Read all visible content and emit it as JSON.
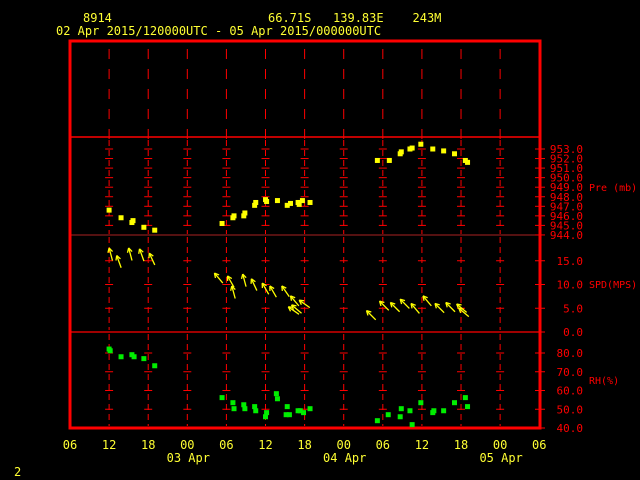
{
  "header": {
    "station_id": "8914",
    "location": "66.71S   139.83E    243M",
    "period": "02 Apr 2015/120000UTC - 05 Apr 2015/000000UTC"
  },
  "footer": {
    "page_number": "2"
  },
  "colors": {
    "frame": "#ff0000",
    "text": "#ffff33",
    "pressure": "#ffff00",
    "wind": "#ffff00",
    "rh": "#00ee00",
    "background": "#000000"
  },
  "chart_data": {
    "type": "scatter",
    "x_axis": {
      "range": [
        "2015-04-02T06:00Z",
        "2015-04-05T06:00Z"
      ],
      "tick_labels": [
        "06",
        "12",
        "18",
        "00",
        "06",
        "12",
        "18",
        "00",
        "06",
        "12",
        "18",
        "00",
        "06"
      ],
      "date_labels": [
        "03 Apr",
        "04 Apr",
        "05 Apr"
      ]
    },
    "panels": [
      {
        "name": "Pre (mb)",
        "tick_labels": [
          "953.0",
          "952.0",
          "951.0",
          "950.0",
          "949.0",
          "948.0",
          "947.0",
          "946.0",
          "945.0",
          "944.0"
        ],
        "ylim": [
          944,
          954.2
        ],
        "series": [
          [
            "2015-04-02T12:00Z",
            946.6
          ],
          [
            "2015-04-02T13:50Z",
            945.8
          ],
          [
            "2015-04-02T15:30Z",
            945.3
          ],
          [
            "2015-04-02T15:40Z",
            945.5
          ],
          [
            "2015-04-02T17:20Z",
            944.8
          ],
          [
            "2015-04-02T19:00Z",
            944.5
          ],
          [
            "2015-04-03T05:20Z",
            945.2
          ],
          [
            "2015-04-03T07:00Z",
            945.8
          ],
          [
            "2015-04-03T07:10Z",
            946.0
          ],
          [
            "2015-04-03T08:40Z",
            946.0
          ],
          [
            "2015-04-03T08:50Z",
            946.3
          ],
          [
            "2015-04-03T10:20Z",
            947.1
          ],
          [
            "2015-04-03T10:30Z",
            947.4
          ],
          [
            "2015-04-03T12:00Z",
            947.7
          ],
          [
            "2015-04-03T12:10Z",
            947.5
          ],
          [
            "2015-04-03T13:50Z",
            947.6
          ],
          [
            "2015-04-03T15:20Z",
            947.1
          ],
          [
            "2015-04-03T15:50Z",
            947.3
          ],
          [
            "2015-04-03T17:00Z",
            947.4
          ],
          [
            "2015-04-03T17:10Z",
            947.2
          ],
          [
            "2015-04-03T17:40Z",
            947.6
          ],
          [
            "2015-04-03T18:50Z",
            947.4
          ],
          [
            "2015-04-04T05:10Z",
            951.8
          ],
          [
            "2015-04-04T07:00Z",
            951.8
          ],
          [
            "2015-04-04T08:40Z",
            952.5
          ],
          [
            "2015-04-04T08:50Z",
            952.7
          ],
          [
            "2015-04-04T10:10Z",
            953.0
          ],
          [
            "2015-04-04T10:30Z",
            953.1
          ],
          [
            "2015-04-04T11:50Z",
            953.5
          ],
          [
            "2015-04-04T13:40Z",
            953.0
          ],
          [
            "2015-04-04T15:20Z",
            952.8
          ],
          [
            "2015-04-04T17:00Z",
            952.5
          ],
          [
            "2015-04-04T18:40Z",
            951.8
          ],
          [
            "2015-04-04T19:00Z",
            951.6
          ]
        ]
      },
      {
        "name": "SPD(MPS)",
        "tick_labels": [
          "15.0",
          "10.0",
          "5.0",
          "0.0"
        ],
        "ylim": [
          0,
          20.4
        ],
        "series_fields": [
          "time",
          "speed",
          "direction_from_deg"
        ],
        "series": [
          [
            "2015-04-02T12:00Z",
            17.7,
            165
          ],
          [
            "2015-04-02T13:10Z",
            16.1,
            160
          ],
          [
            "2015-04-02T15:00Z",
            17.7,
            165
          ],
          [
            "2015-04-02T16:40Z",
            17.5,
            160
          ],
          [
            "2015-04-02T18:10Z",
            16.6,
            155
          ],
          [
            "2015-04-03T04:10Z",
            12.4,
            140
          ],
          [
            "2015-04-03T06:10Z",
            11.8,
            150
          ],
          [
            "2015-04-03T06:50Z",
            9.7,
            165
          ],
          [
            "2015-04-03T08:30Z",
            12.2,
            165
          ],
          [
            "2015-04-03T09:50Z",
            11.2,
            155
          ],
          [
            "2015-04-03T11:30Z",
            10.3,
            150
          ],
          [
            "2015-04-03T12:40Z",
            9.7,
            150
          ],
          [
            "2015-04-03T14:30Z",
            9.7,
            145
          ],
          [
            "2015-04-03T15:30Z",
            5.3,
            125
          ],
          [
            "2015-04-03T15:50Z",
            7.6,
            140
          ],
          [
            "2015-04-03T16:00Z",
            5.7,
            130
          ],
          [
            "2015-04-03T17:10Z",
            6.7,
            125
          ],
          [
            "2015-04-04T03:30Z",
            4.5,
            135
          ],
          [
            "2015-04-04T05:30Z",
            6.5,
            135
          ],
          [
            "2015-04-04T07:10Z",
            6.2,
            135
          ],
          [
            "2015-04-04T08:40Z",
            6.9,
            135
          ],
          [
            "2015-04-04T10:20Z",
            6.0,
            140
          ],
          [
            "2015-04-04T12:10Z",
            7.6,
            140
          ],
          [
            "2015-04-04T14:00Z",
            6.0,
            135
          ],
          [
            "2015-04-04T15:40Z",
            6.2,
            135
          ],
          [
            "2015-04-04T17:20Z",
            5.9,
            130
          ],
          [
            "2015-04-04T17:40Z",
            5.0,
            130
          ]
        ]
      },
      {
        "name": "RH(%)",
        "tick_labels": [
          "80.0",
          "70.0",
          "60.0",
          "50.0",
          "40.0"
        ],
        "ylim": [
          40,
          91.2
        ],
        "series": [
          [
            "2015-04-02T12:00Z",
            82.1
          ],
          [
            "2015-04-02T12:10Z",
            81.2
          ],
          [
            "2015-04-02T13:50Z",
            78.0
          ],
          [
            "2015-04-02T15:30Z",
            79.1
          ],
          [
            "2015-04-02T15:50Z",
            78.0
          ],
          [
            "2015-04-02T17:20Z",
            77.0
          ],
          [
            "2015-04-02T19:00Z",
            73.2
          ],
          [
            "2015-04-03T05:20Z",
            56.2
          ],
          [
            "2015-04-03T07:00Z",
            53.5
          ],
          [
            "2015-04-03T07:10Z",
            50.3
          ],
          [
            "2015-04-03T08:40Z",
            52.4
          ],
          [
            "2015-04-03T08:50Z",
            50.3
          ],
          [
            "2015-04-03T10:20Z",
            51.4
          ],
          [
            "2015-04-03T10:30Z",
            49.2
          ],
          [
            "2015-04-03T12:00Z",
            46.0
          ],
          [
            "2015-04-03T12:10Z",
            48.2
          ],
          [
            "2015-04-03T13:40Z",
            58.3
          ],
          [
            "2015-04-03T13:50Z",
            55.6
          ],
          [
            "2015-04-03T15:20Z",
            51.4
          ],
          [
            "2015-04-03T15:10Z",
            47.1
          ],
          [
            "2015-04-03T15:40Z",
            47.1
          ],
          [
            "2015-04-03T17:00Z",
            49.2
          ],
          [
            "2015-04-03T17:20Z",
            49.2
          ],
          [
            "2015-04-03T17:50Z",
            48.2
          ],
          [
            "2015-04-03T18:50Z",
            50.3
          ],
          [
            "2015-04-04T05:10Z",
            43.9
          ],
          [
            "2015-04-04T06:50Z",
            47.1
          ],
          [
            "2015-04-04T08:40Z",
            46.0
          ],
          [
            "2015-04-04T08:50Z",
            50.3
          ],
          [
            "2015-04-04T10:10Z",
            49.2
          ],
          [
            "2015-04-04T10:30Z",
            41.8
          ],
          [
            "2015-04-04T11:50Z",
            53.5
          ],
          [
            "2015-04-04T13:40Z",
            48.2
          ],
          [
            "2015-04-04T13:50Z",
            49.2
          ],
          [
            "2015-04-04T15:20Z",
            49.2
          ],
          [
            "2015-04-04T17:00Z",
            53.5
          ],
          [
            "2015-04-04T18:40Z",
            56.2
          ],
          [
            "2015-04-04T19:00Z",
            51.4
          ]
        ]
      }
    ]
  }
}
